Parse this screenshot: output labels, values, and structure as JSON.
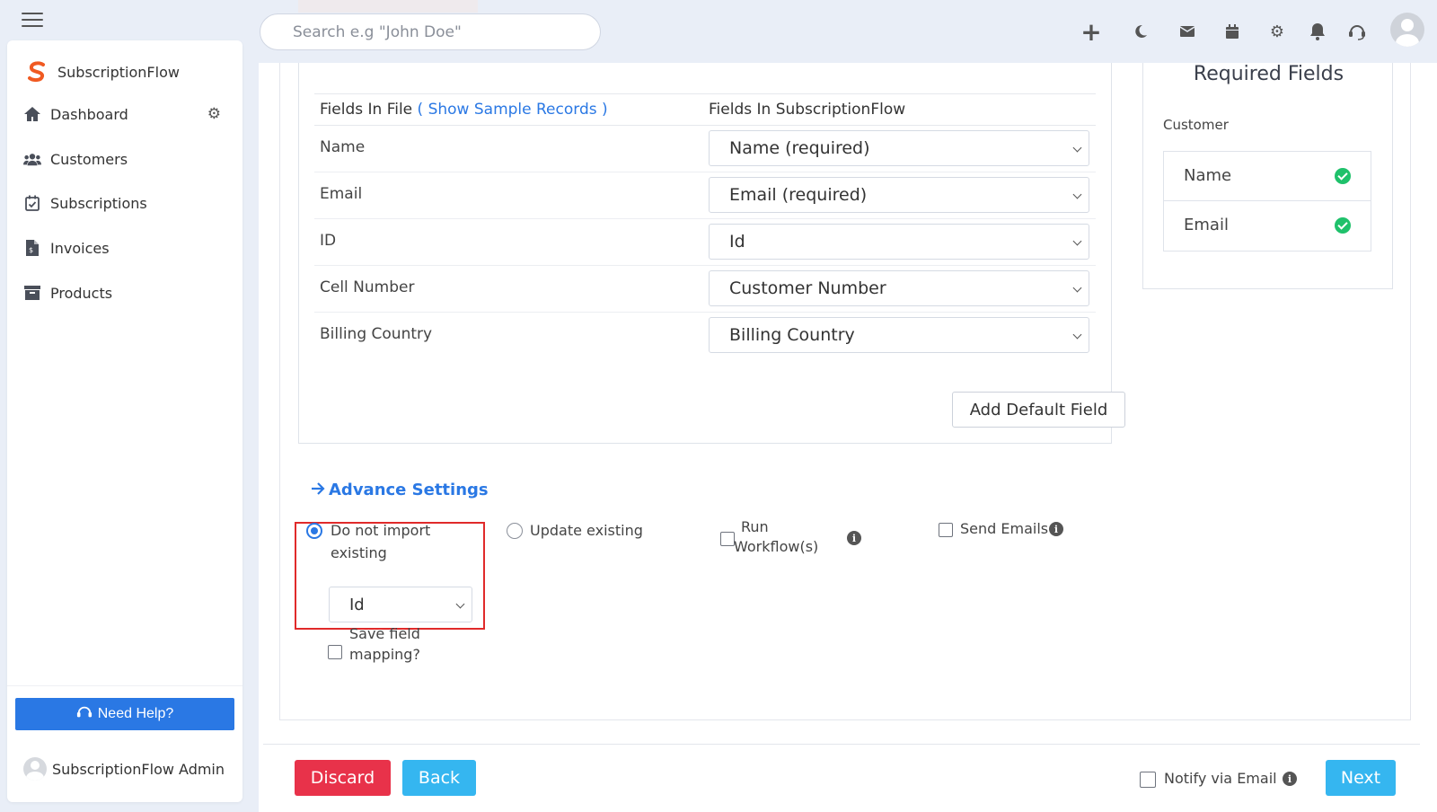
{
  "topbar": {
    "search_placeholder": "Search e.g \"John Doe\"",
    "icons": [
      "plus-icon",
      "moon-icon",
      "mail-icon",
      "calendar-icon",
      "gear-icon",
      "bell-icon",
      "headset-icon",
      "avatar"
    ]
  },
  "sidebar": {
    "brand": "SubscriptionFlow",
    "items": [
      {
        "label": "Dashboard",
        "icon": "home-icon"
      },
      {
        "label": "Customers",
        "icon": "users-icon"
      },
      {
        "label": "Subscriptions",
        "icon": "calendar-check-icon"
      },
      {
        "label": "Invoices",
        "icon": "file-invoice-icon"
      },
      {
        "label": "Products",
        "icon": "archive-icon"
      }
    ],
    "help_label": "Need Help?",
    "admin_label": "SubscriptionFlow Admin"
  },
  "mapping": {
    "col1_label": "Fields In File",
    "col1_link": "( Show Sample Records )",
    "col2_label": "Fields In SubscriptionFlow",
    "rows": [
      {
        "file_field": "Name",
        "mapped": "Name (required)"
      },
      {
        "file_field": "Email",
        "mapped": "Email (required)"
      },
      {
        "file_field": "ID",
        "mapped": "Id"
      },
      {
        "file_field": "Cell Number",
        "mapped": "Customer Number"
      },
      {
        "file_field": "Billing Country",
        "mapped": "Billing Country"
      }
    ],
    "add_default_label": "Add Default Field"
  },
  "advance": {
    "title": "Advance Settings",
    "do_not_import_line1": "Do not import",
    "do_not_import_line2": "existing",
    "do_not_import_selected": "Id",
    "update_existing": "Update existing",
    "run_workflow_line1": "Run",
    "run_workflow_line2": "Workflow(s)",
    "send_emails": "Send Emails",
    "save_mapping_line1": "Save field",
    "save_mapping_line2": "mapping?"
  },
  "footer": {
    "discard": "Discard",
    "back": "Back",
    "notify": "Notify via Email",
    "next": "Next"
  },
  "required": {
    "title": "Required Fields",
    "section": "Customer",
    "items": [
      "Name",
      "Email"
    ]
  },
  "colors": {
    "primary": "#2a78e4",
    "danger": "#e8324a",
    "info": "#35b6f0",
    "success": "#1fc16b",
    "highlight": "#e02a2a"
  }
}
